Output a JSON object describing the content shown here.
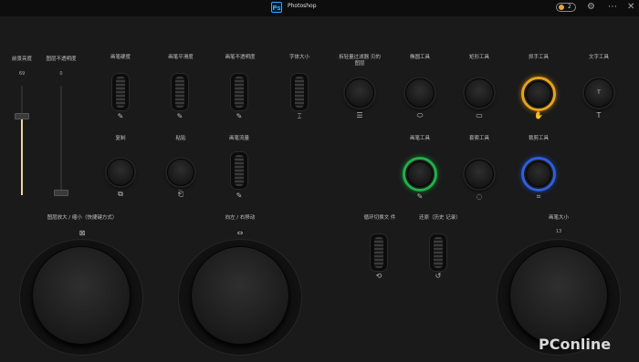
{
  "titlebar": {
    "app_title": "Photoshop",
    "logo_text": "Ps",
    "badge_count": "2",
    "settings_icon": "gear-icon",
    "more_icon": "more-icon",
    "close_icon": "close-icon"
  },
  "sliders": [
    {
      "label": "前景亮度",
      "value": "69"
    },
    {
      "label": "图层不透明度",
      "value": "0"
    }
  ],
  "wheels_row1": [
    {
      "label": "画笔硬度",
      "icon": "brush-icon"
    },
    {
      "label": "画笔平滑度",
      "icon": "brush-icon"
    },
    {
      "label": "画笔不透明度",
      "icon": "brush-icon"
    },
    {
      "label": "字体大小",
      "icon": "text-size-icon"
    }
  ],
  "knobs_row1": [
    {
      "label": "拆轻量过滤器 贝的图层",
      "icon": "layers-icon"
    },
    {
      "label": "椭圆工具",
      "icon": "ellipse-icon"
    },
    {
      "label": "矩形工具",
      "icon": "rectangle-icon"
    },
    {
      "label": "抓手工具",
      "icon": "hand-icon",
      "ring_color": "#e8a317"
    },
    {
      "label": "文字工具",
      "icon": "text-icon",
      "center_text": "T"
    }
  ],
  "row2": [
    {
      "label": "复制",
      "icon": "copy-icon"
    },
    {
      "label": "粘贴",
      "icon": "paste-icon"
    },
    {
      "label": "画笔流量",
      "icon": "brush-icon"
    }
  ],
  "knobs_row2": [
    {
      "label": "画笔工具",
      "icon": "brush-icon",
      "ring_color": "#22b04a"
    },
    {
      "label": "套索工具",
      "icon": "lasso-icon"
    },
    {
      "label": "裁剪工具",
      "icon": "crop-icon",
      "ring_color": "#2f5fe0"
    }
  ],
  "big_dials": [
    {
      "label": "图层放大 / 缩小（快捷键方式）",
      "icon": "zoom-icon"
    },
    {
      "label": "向左 / 右移动",
      "icon": "arrows-horizontal-icon"
    },
    {
      "label": "画笔大小",
      "value": "13"
    }
  ],
  "bottom_wheels": [
    {
      "label": "循环切换文 件",
      "icon": "cycle-icon"
    },
    {
      "label": "还原（历史 记录）",
      "icon": "undo-icon"
    }
  ],
  "watermark": "PConline"
}
